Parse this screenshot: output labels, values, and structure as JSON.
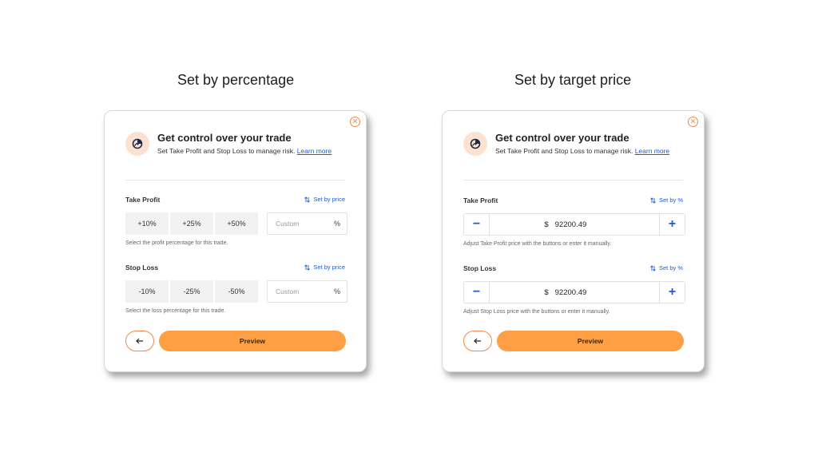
{
  "titles": {
    "left": "Set by percentage",
    "right": "Set by target price"
  },
  "header": {
    "title": "Get control over your trade",
    "description": "Set Take Profit and Stop Loss to manage risk.",
    "learn_more": "Learn more"
  },
  "percentage_panel": {
    "take_profit": {
      "label": "Take Profit",
      "switch_label": "Set by price",
      "options": [
        "+10%",
        "+25%",
        "+50%"
      ],
      "custom_placeholder": "Custom",
      "unit": "%",
      "helper": "Select the profit percentage for this trade."
    },
    "stop_loss": {
      "label": "Stop Loss",
      "switch_label": "Set by price",
      "options": [
        "-10%",
        "-25%",
        "-50%"
      ],
      "custom_placeholder": "Custom",
      "unit": "%",
      "helper": "Select the loss percentage for this trade."
    }
  },
  "price_panel": {
    "take_profit": {
      "label": "Take Profit",
      "switch_label": "Set by %",
      "currency": "$",
      "value": "92200.49",
      "minus": "−",
      "plus": "+",
      "helper": "Adjust Take Profit price with the buttons or enter it manually."
    },
    "stop_loss": {
      "label": "Stop Loss",
      "switch_label": "Set by %",
      "currency": "$",
      "value": "92200.49",
      "minus": "−",
      "plus": "+",
      "helper": "Adjust Stop Loss price with the buttons or enter it manually."
    }
  },
  "footer": {
    "preview_label": "Preview"
  },
  "icons": {
    "close": "close-icon",
    "badge": "chart-gauge-icon",
    "switch": "swap-arrows-icon",
    "back": "arrow-left-icon"
  },
  "colors": {
    "accent": "#fd9f42",
    "accent_border": "#f08a4b",
    "link": "#1a5bd8",
    "badge_bg": "#fde3cf"
  }
}
